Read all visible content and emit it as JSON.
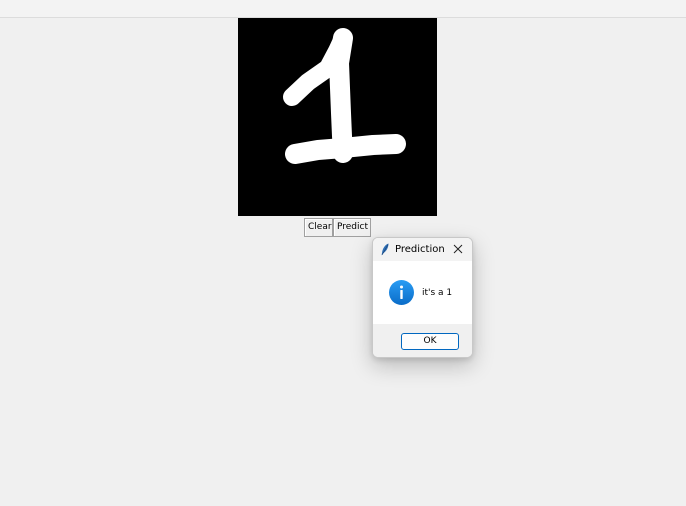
{
  "canvas": {
    "background": "#000000",
    "stroke_color": "#ffffff",
    "drawing": "handwritten digit 1"
  },
  "buttons": {
    "clear_label": "Clear",
    "predict_label": "Predict"
  },
  "dialog": {
    "title": "Prediction",
    "icon": "info-icon",
    "message": "it's a 1",
    "ok_label": "OK",
    "accent_color": "#0067c0"
  }
}
